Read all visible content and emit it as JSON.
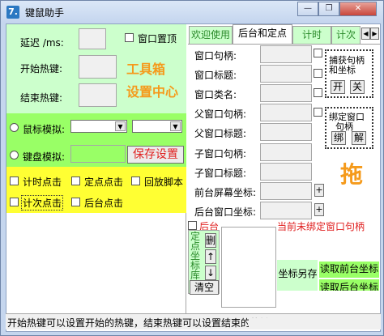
{
  "window": {
    "title": "键鼠助手",
    "icon": "app-icon",
    "min_label": "—",
    "restore_label": "❐",
    "close_label": "✕"
  },
  "left": {
    "delay_label": "延迟 /ms:",
    "start_hotkey_label": "开始热键:",
    "end_hotkey_label": "结束热键:",
    "topmost_label": "窗口置顶",
    "toolbox_line1": "工具箱",
    "toolbox_line2": "设置中心",
    "mouse_sim_label": "鼠标模拟:",
    "keyboard_sim_label": "键盘模拟:",
    "save_settings_label": "保存设置",
    "timer_click_label": "计时点击",
    "fixed_click_label": "定点点击",
    "replay_script_label": "回放脚本",
    "count_click_label": "计次点击",
    "bg_click_label": "后台点击"
  },
  "tabs": [
    {
      "label": "欢迎使用"
    },
    {
      "label": "后台和定点"
    },
    {
      "label": "计时"
    },
    {
      "label": "计次"
    }
  ],
  "right": {
    "handle_label": "窗口句柄:",
    "title_label": "窗口标题:",
    "class_label": "窗口类名:",
    "parent_handle_label": "父窗口句柄:",
    "parent_title_label": "父窗口标题:",
    "child_handle_label": "子窗口句柄:",
    "child_title_label": "子窗口标题:",
    "fg_screen_coord_label": "前台屏幕坐标:",
    "bg_window_coord_label": "后台窗口坐标:",
    "capture_group_line1": "捕获句柄",
    "capture_group_line2": "和坐标",
    "capture_on_label": "开",
    "capture_off_label": "关",
    "bind_group_line1": "绑定窗口",
    "bind_group_line2": "句柄",
    "bind_label": "绑",
    "unbind_label": "解",
    "drag_label": "拖",
    "bg_label": "后台",
    "not_bound_status": "当前未绑定窗口句柄",
    "fixed_coord_lib_label": "定点坐标库",
    "delete_label": "删",
    "up_label": "↑",
    "down_label": "↓",
    "clear_label": "清空",
    "save_coord_label": "坐标另存",
    "read_fg_coord_label": "读取前台坐标",
    "read_bg_coord_label": "读取后台坐标",
    "plus_label": "+"
  },
  "statusbar": {
    "text": "开始热键可以设置开始的热键，结束热键可以设置结束的热键"
  },
  "colors": {
    "title_bg": "#c5d6ee",
    "green": "#ccffcc",
    "yellow": "#ffff33",
    "orange": "#f59a1b",
    "red": "#e02020",
    "blue_text": "#2a6fd6"
  }
}
